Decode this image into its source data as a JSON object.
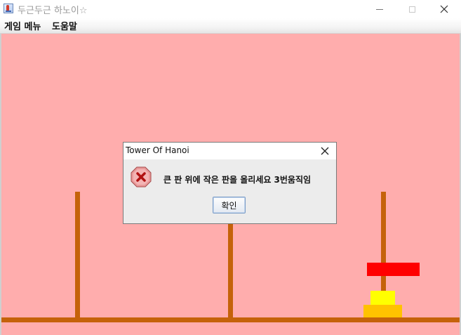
{
  "window": {
    "title": "두근두근 하노이☆"
  },
  "menu": {
    "game": "게임 메뉴",
    "help": "도움말"
  },
  "game": {
    "background_color": "#ffadad",
    "pole_color": "#c5620a",
    "disks": [
      {
        "name": "red-disk",
        "color": "#ff0000"
      },
      {
        "name": "yellow-disk",
        "color": "#ffff00"
      },
      {
        "name": "orange-disk",
        "color": "#ffc200"
      }
    ]
  },
  "dialog": {
    "title": "Tower Of Hanoi",
    "message": "큰 판 위에 작은 판을 올리세요  3번움직임",
    "ok_label": "확인",
    "icon": "error-icon"
  }
}
